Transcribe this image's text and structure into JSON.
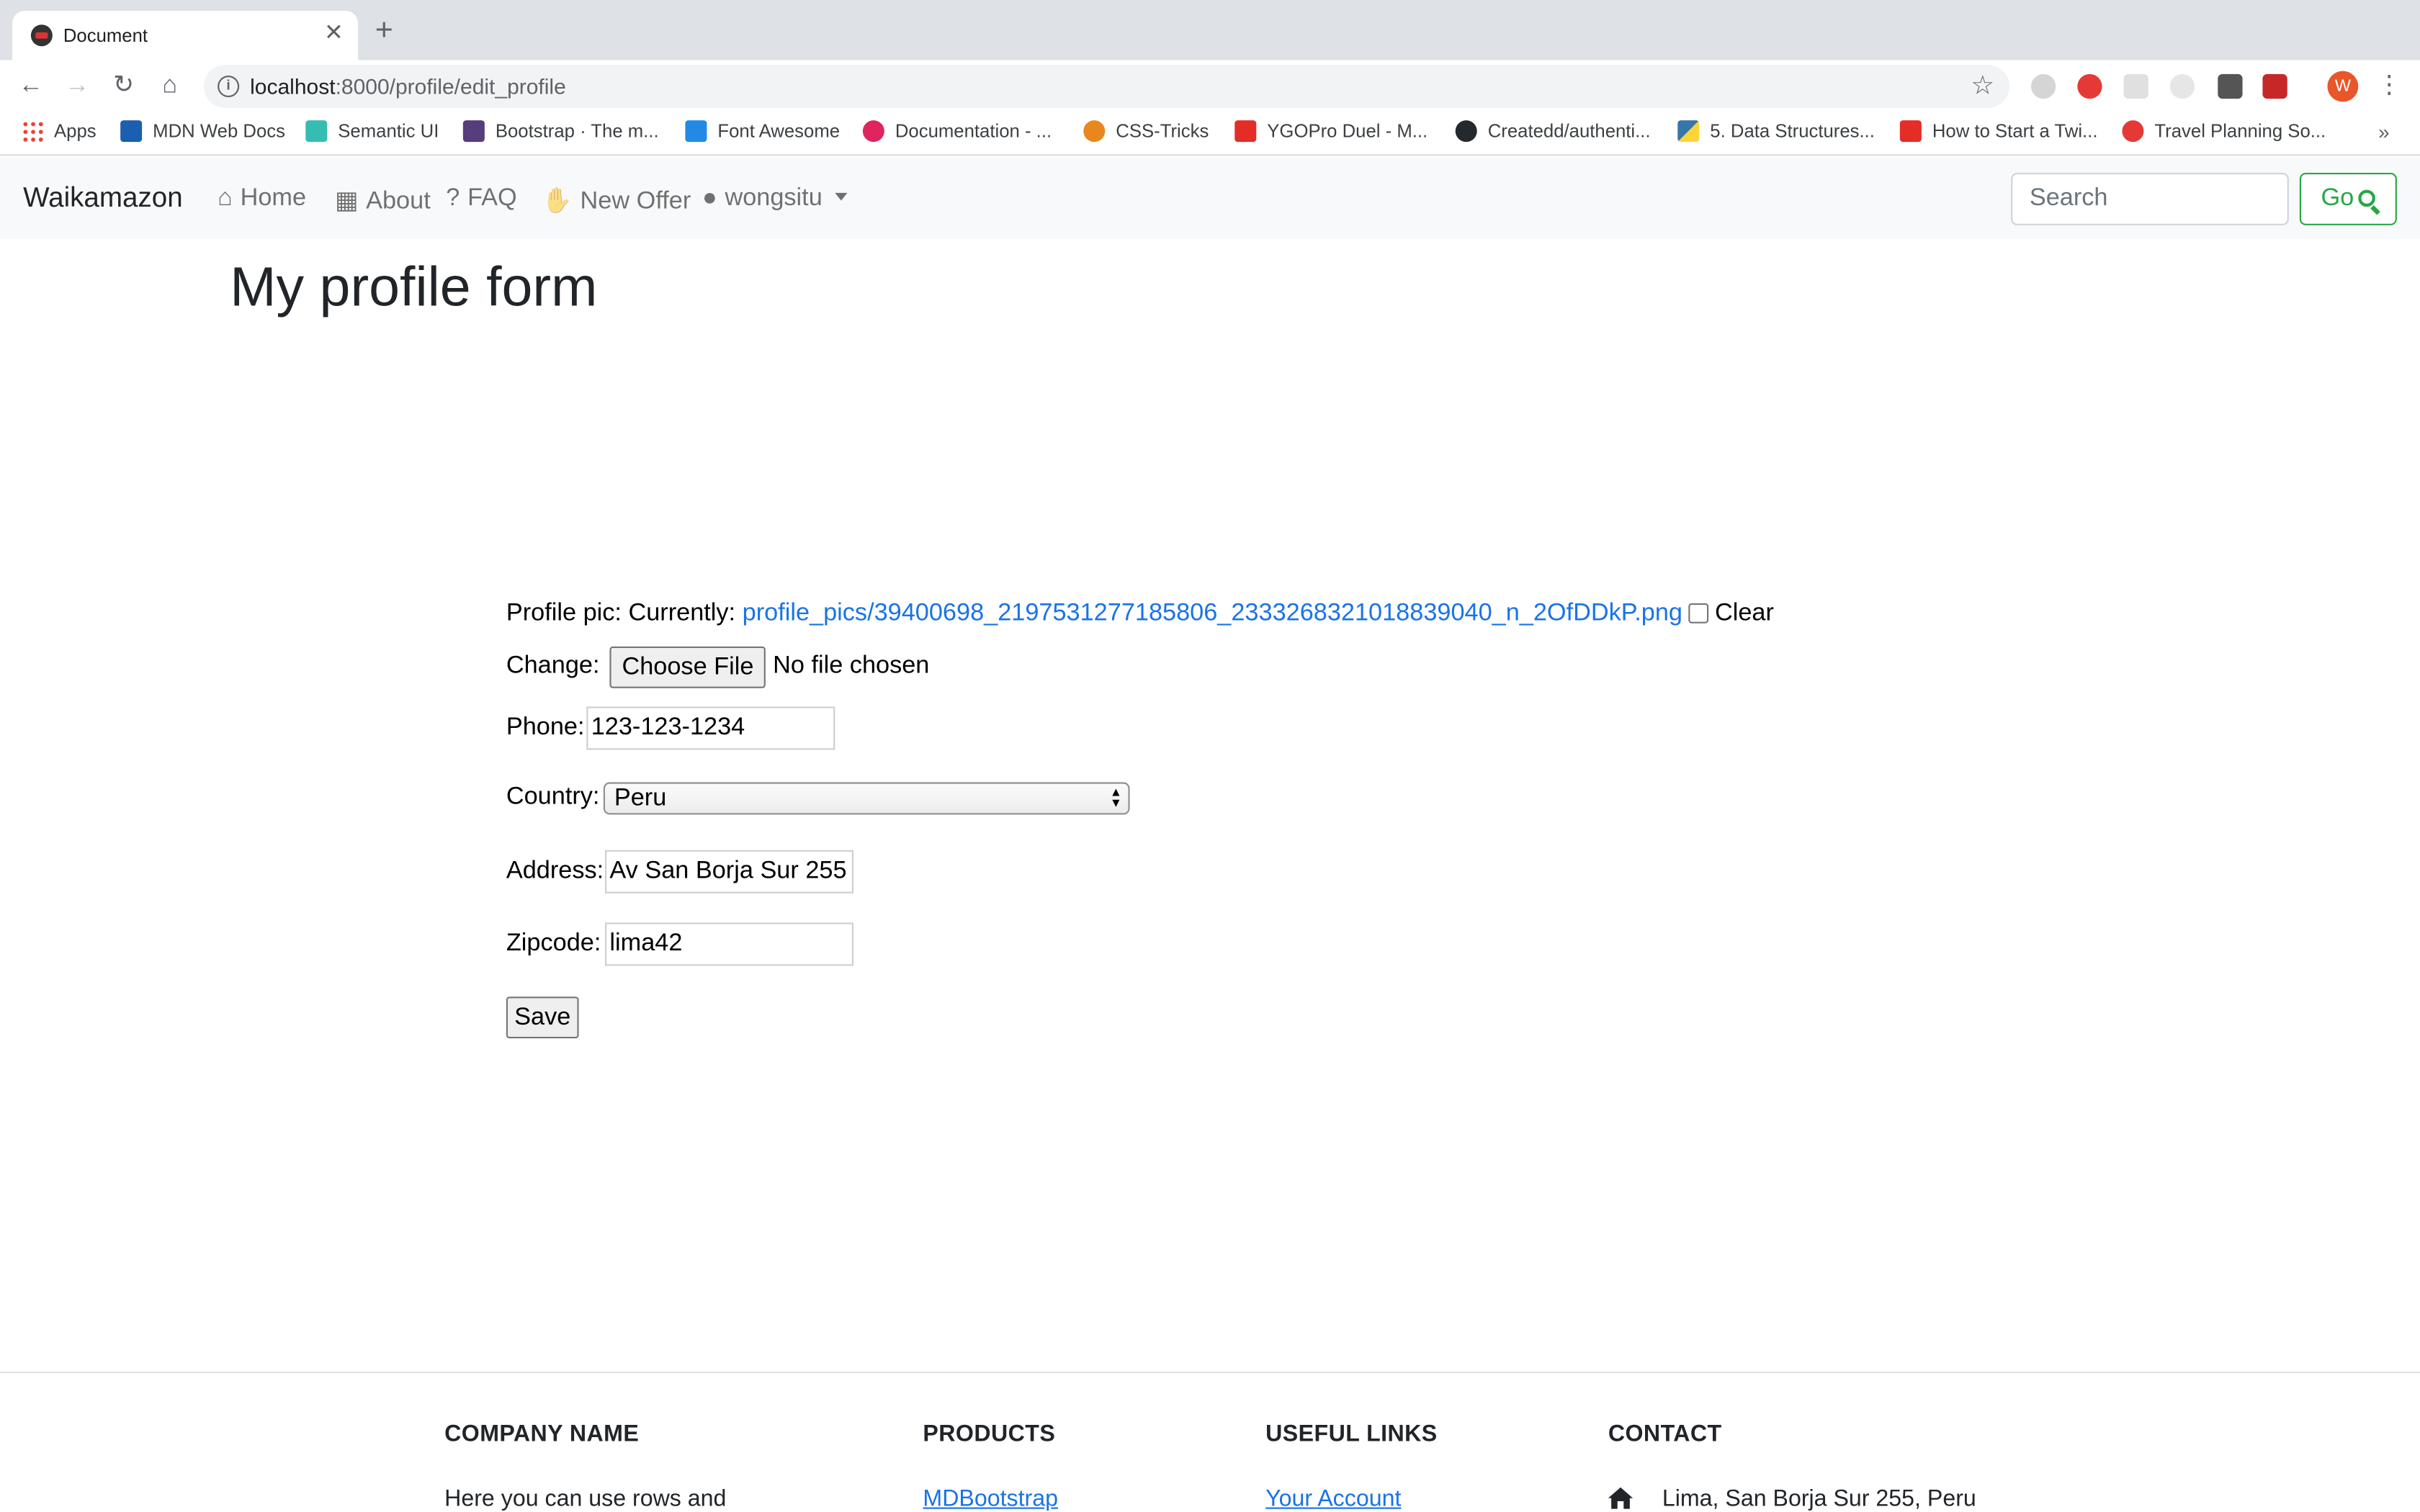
{
  "browser": {
    "tab_title": "Document",
    "url_host": "localhost",
    "url_path": ":8000/profile/edit_profile",
    "avatar_letter": "W",
    "bookmarks": [
      {
        "label": "Apps",
        "color": "#4285f4"
      },
      {
        "label": "MDN Web Docs",
        "color": "#1b5fb0"
      },
      {
        "label": "Semantic UI",
        "color": "#35bdb2"
      },
      {
        "label": "Bootstrap · The m...",
        "color": "#563d7c"
      },
      {
        "label": "Font Awesome",
        "color": "#228ae6"
      },
      {
        "label": "Documentation - ...",
        "color": "#e0245e"
      },
      {
        "label": "CSS-Tricks",
        "color": "#e8871e"
      },
      {
        "label": "YGOPro Duel - M...",
        "color": "#e52d27"
      },
      {
        "label": "Createdd/authenti...",
        "color": "#24292e"
      },
      {
        "label": "5. Data Structures...",
        "color": "#3776ab"
      },
      {
        "label": "How to Start a Twi...",
        "color": "#e52d27"
      },
      {
        "label": "Travel Planning So...",
        "color": "#e53935"
      }
    ]
  },
  "navbar": {
    "brand": "Waikamazon",
    "links": [
      "Home",
      "About",
      "FAQ",
      "New Offer",
      "wongsitu"
    ],
    "search_placeholder": "Search",
    "go_label": "Go"
  },
  "page": {
    "title": "My profile form"
  },
  "form": {
    "profile_pic_label": "Profile pic:",
    "currently_label": "Currently:",
    "profile_pic_link": "profile_pics/39400698_2197531277185806_2333268321018839040_n_2OfDDkP.png",
    "clear_label": "Clear",
    "change_label": "Change:",
    "choose_file_label": "Choose File",
    "no_file_text": "No file chosen",
    "phone_label": "Phone:",
    "phone_value": "123-123-1234",
    "country_label": "Country:",
    "country_value": "Peru",
    "address_label": "Address:",
    "address_value": "Av San Borja Sur 255",
    "zipcode_label": "Zipcode:",
    "zipcode_value": "lima42",
    "save_label": "Save"
  },
  "footer": {
    "company_heading": "COMPANY NAME",
    "company_text": "Here you can use rows and",
    "products_heading": "PRODUCTS",
    "products_link": "MDBootstrap",
    "useful_heading": "USEFUL LINKS",
    "useful_link": "Your Account",
    "contact_heading": "CONTACT",
    "contact_address": "Lima, San Borja Sur 255, Peru"
  }
}
